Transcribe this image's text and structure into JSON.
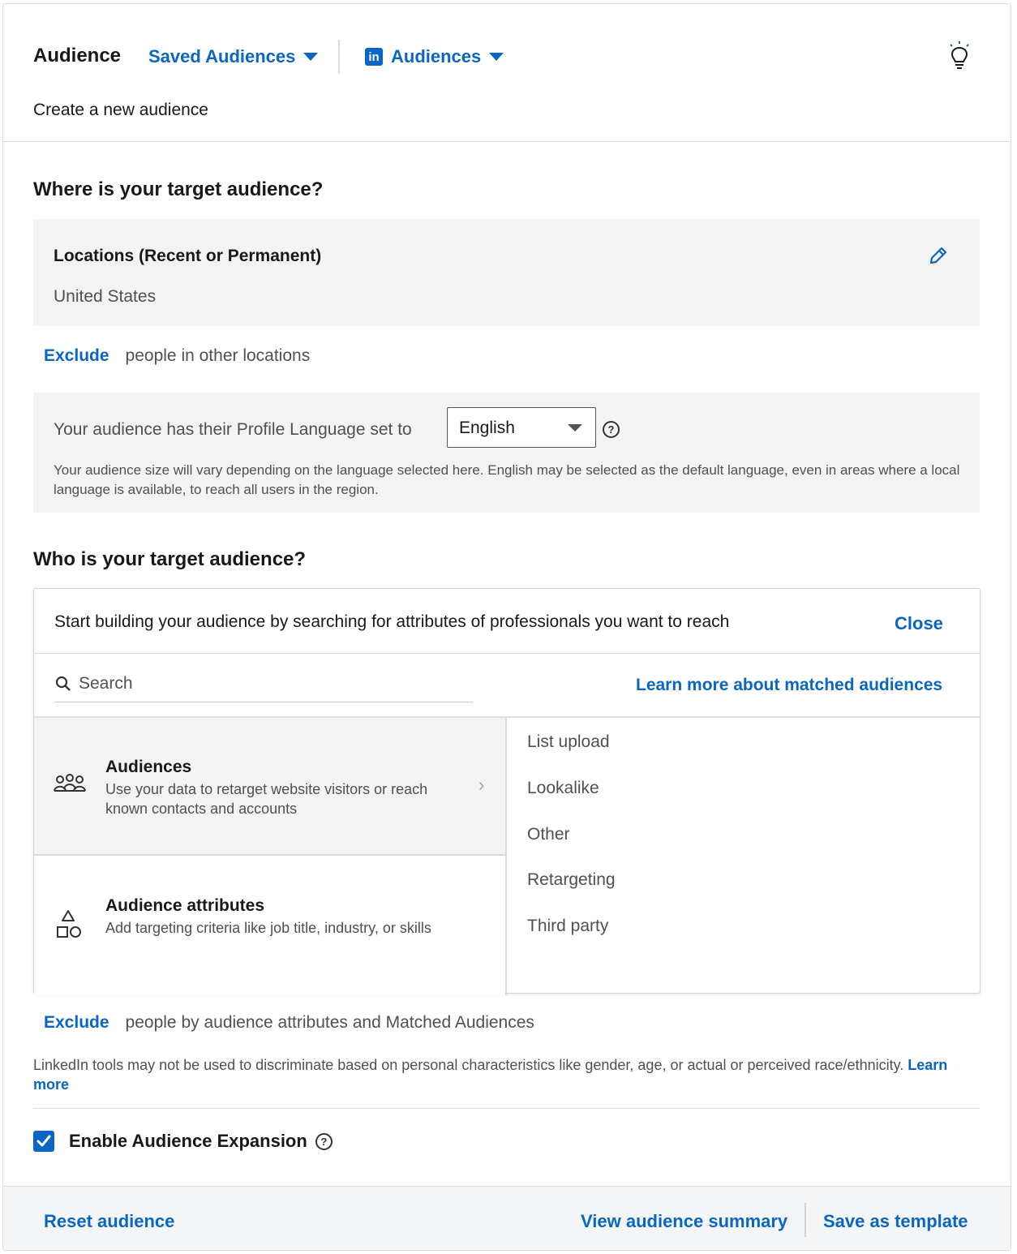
{
  "header": {
    "title": "Audience",
    "saved_audiences": "Saved Audiences",
    "audiences_menu": "Audiences",
    "subtitle": "Create a new audience"
  },
  "where": {
    "heading": "Where is your target audience?",
    "locations_title": "Locations (Recent or Permanent)",
    "locations_value": "United States",
    "exclude_label": "Exclude",
    "exclude_text": "people in other locations",
    "language_label": "Your audience has their Profile Language set to",
    "language_value": "English",
    "language_note": "Your audience size will vary depending on the language selected here. English may be selected as the default language, even in areas where a local language is available, to reach all users in the region."
  },
  "who": {
    "heading": "Who is your target audience?",
    "builder_prompt": "Start building your audience by searching for attributes of professionals you want to reach",
    "close_label": "Close",
    "search_placeholder": "Search",
    "learn_more_matched": "Learn more about matched audiences",
    "categories": [
      {
        "title": "Audiences",
        "desc": "Use your data to retarget website visitors or reach known contacts and accounts",
        "icon": "people-group-icon"
      },
      {
        "title": "Audience attributes",
        "desc": "Add targeting criteria like job title, industry, or skills",
        "icon": "shapes-icon"
      }
    ],
    "subitems": [
      "List upload",
      "Lookalike",
      "Other",
      "Retargeting",
      "Third party"
    ],
    "exclude_label": "Exclude",
    "exclude_text": "people by audience attributes and Matched Audiences"
  },
  "disclaimer": {
    "text": "LinkedIn tools may not be used to discriminate based on personal characteristics like gender, age, or actual or perceived race/ethnicity.",
    "link": "Learn more"
  },
  "expansion": {
    "label": "Enable Audience Expansion",
    "checked": true
  },
  "footer": {
    "reset": "Reset audience",
    "view_summary": "View audience summary",
    "save_template": "Save as template"
  },
  "colors": {
    "accent": "#0a66c2",
    "panel_gray": "#f3f3f3",
    "text_secondary": "#505050"
  }
}
